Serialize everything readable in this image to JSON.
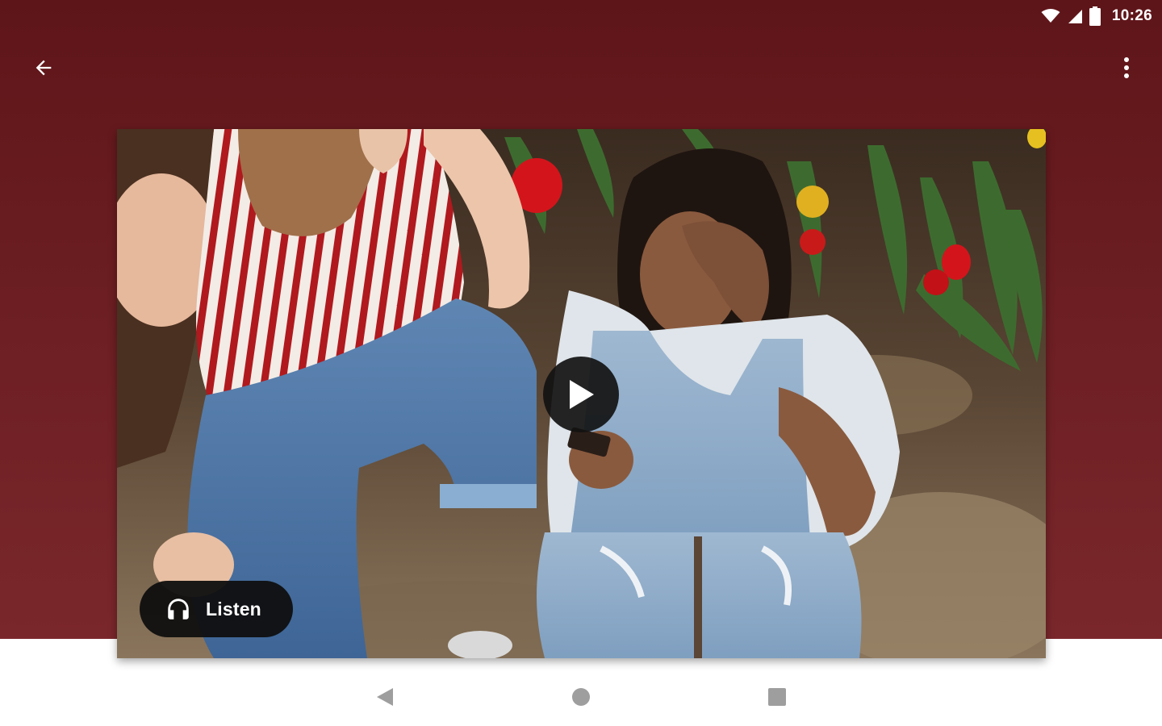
{
  "status_bar": {
    "time": "10:26",
    "icons": [
      "wifi-icon",
      "cell-signal-icon",
      "battery-icon"
    ]
  },
  "app_bar": {
    "back_icon": "arrow-left-icon",
    "menu_icon": "more-vert-icon"
  },
  "media": {
    "play_icon": "play-icon",
    "listen_icon": "headphones-icon",
    "listen_label": "Listen"
  },
  "nav_bar": {
    "icons": [
      "nav-back-icon",
      "nav-home-icon",
      "nav-recents-icon"
    ]
  },
  "colors": {
    "header_background": "#6a1d21",
    "overlay_button": "#121212",
    "nav_icon": "#9e9e9e"
  }
}
